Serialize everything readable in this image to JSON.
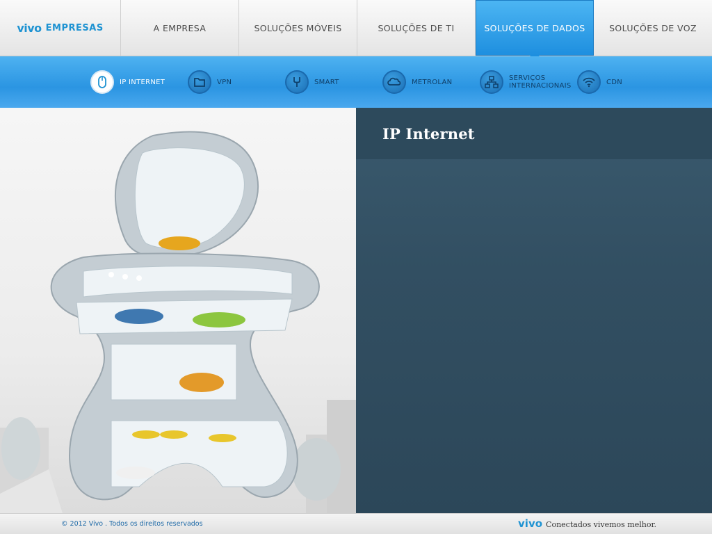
{
  "header": {
    "brand_logo": "vivo",
    "brand_suffix": "EMPRESAS",
    "nav": [
      {
        "label": "A EMPRESA",
        "active": false
      },
      {
        "label": "SOLUÇÕES MÓVEIS",
        "active": false
      },
      {
        "label": "SOLUÇÕES DE TI",
        "active": false
      },
      {
        "label": "SOLUÇÕES DE DADOS",
        "active": true
      },
      {
        "label": "SOLUÇÕES DE VOZ",
        "active": false
      }
    ]
  },
  "subnav": {
    "items": [
      {
        "label": "IP INTERNET",
        "icon": "mouse-icon",
        "active": true
      },
      {
        "label": "VPN",
        "icon": "folder-icon",
        "active": false
      },
      {
        "label": "SMART",
        "icon": "tools-icon",
        "active": false
      },
      {
        "label": "METROLAN",
        "icon": "cloud-icon",
        "active": false
      },
      {
        "label_line1": "SERVIÇOS",
        "label_line2": "INTERNACIONAIS",
        "icon": "network-icon",
        "active": false
      },
      {
        "label": "CDN",
        "icon": "wifi-icon",
        "active": false
      }
    ]
  },
  "content": {
    "title": "IP Internet"
  },
  "footer": {
    "copyright": "© 2012 Vivo . Todos os direitos reservados",
    "tagline_logo": "vivo",
    "tagline": "Conectados vivemos melhor."
  },
  "colors": {
    "accent": "#1f93d2",
    "active_tab": "#2b9cea",
    "content_panel": "#324f62"
  }
}
